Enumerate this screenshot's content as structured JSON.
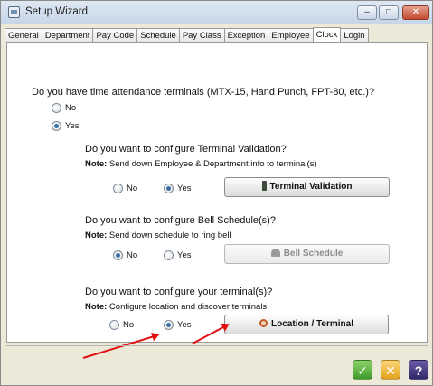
{
  "window": {
    "title": "Setup Wizard",
    "controls": {
      "minimize": "–",
      "maximize": "□",
      "close": "✕"
    }
  },
  "tabs": [
    {
      "label": "General",
      "active": false
    },
    {
      "label": "Department",
      "active": false
    },
    {
      "label": "Pay Code",
      "active": false
    },
    {
      "label": "Schedule",
      "active": false
    },
    {
      "label": "Pay Class",
      "active": false
    },
    {
      "label": "Exception",
      "active": false
    },
    {
      "label": "Employee",
      "active": false
    },
    {
      "label": "Clock",
      "active": true
    },
    {
      "label": "Login",
      "active": false
    }
  ],
  "main": {
    "question": "Do you have time attendance terminals (MTX-15, Hand Punch, FPT-80, etc.)?",
    "options": {
      "no": "No",
      "yes": "Yes",
      "selected": "Yes"
    },
    "sections": [
      {
        "question": "Do you want to configure Terminal Validation?",
        "note_label": "Note:",
        "note_text": " Send down Employee & Department info to terminal(s)",
        "no": "No",
        "yes": "Yes",
        "selected": "Yes",
        "button": {
          "label": "Terminal Validation",
          "icon": "terminal-icon",
          "enabled": true
        }
      },
      {
        "question": "Do you want to configure Bell Schedule(s)?",
        "note_label": "Note:",
        "note_text": " Send down schedule to ring bell",
        "no": "No",
        "yes": "Yes",
        "selected": "No",
        "button": {
          "label": "Bell Schedule",
          "icon": "bell-icon",
          "enabled": false
        }
      },
      {
        "question": "Do you want to configure your terminal(s)?",
        "note_label": "Note:",
        "note_text": " Configure location and discover terminals",
        "no": "No",
        "yes": "Yes",
        "selected": "Yes",
        "button": {
          "label": "Location / Terminal",
          "icon": "location-icon",
          "enabled": true
        }
      }
    ]
  },
  "footer": {
    "ok_icon": "✓",
    "cancel_icon": "✕",
    "help_icon": "?"
  },
  "colors": {
    "annotation_arrow": "#e01010",
    "ok": "#3f9b2b",
    "cancel": "#e3a21d",
    "help": "#2f2a6b"
  }
}
